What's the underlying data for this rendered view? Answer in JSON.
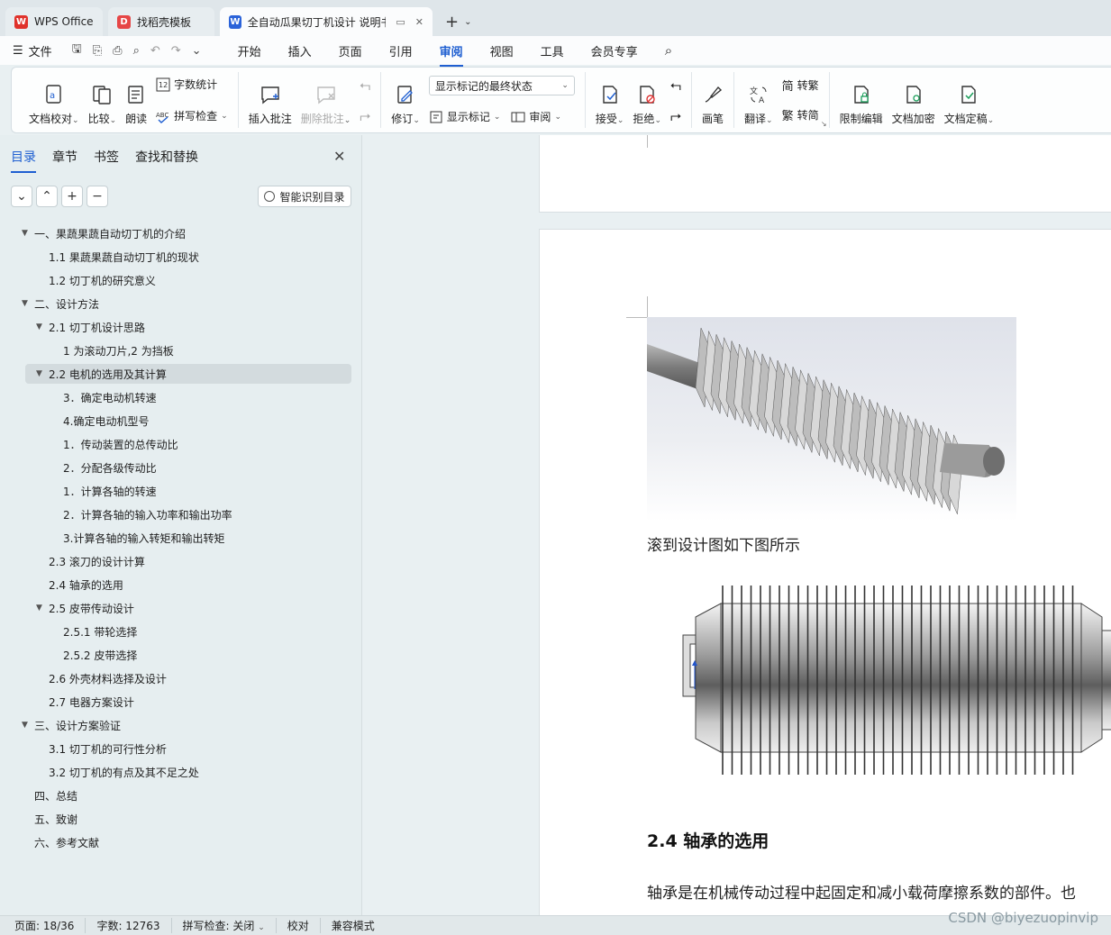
{
  "tabs": [
    {
      "label": "WPS Office",
      "logo": "W",
      "color": "#e0322b"
    },
    {
      "label": "找稻壳模板",
      "logo": "D",
      "color": "#e64646"
    },
    {
      "label": "全自动瓜果切丁机设计 说明书",
      "logo": "W",
      "color": "#2b63d9"
    }
  ],
  "menu": {
    "file_label": "文件",
    "items": [
      "开始",
      "插入",
      "页面",
      "引用",
      "审阅",
      "视图",
      "工具",
      "会员专享"
    ],
    "active_index": 4
  },
  "ribbon": {
    "proofread": "文档校对",
    "compare": "比较",
    "read_aloud": "朗读",
    "word_count": "字数统计",
    "spell_check": "拼写检查",
    "insert_comment": "插入批注",
    "delete_comment": "删除批注",
    "revise": "修订",
    "markup_state": "显示标记的最终状态",
    "show_markup": "显示标记",
    "review": "审阅",
    "accept": "接受",
    "reject": "拒绝",
    "pen": "画笔",
    "translate": "翻译",
    "to_traditional": "转繁",
    "to_simplified": "转简",
    "restrict_edit": "限制编辑",
    "encrypt": "文档加密",
    "finalize": "文档定稿"
  },
  "panel": {
    "tabs": [
      "目录",
      "章节",
      "书签",
      "查找和替换"
    ],
    "smart_button": "智能识别目录",
    "toc": [
      {
        "text": "一、果蔬果蔬自动切丁机的介绍",
        "level": 1,
        "arrow": true
      },
      {
        "text": "1.1 果蔬果蔬自动切丁机的现状",
        "level": 2,
        "arrow": false
      },
      {
        "text": "1.2 切丁机的研究意义",
        "level": 2,
        "arrow": false
      },
      {
        "text": "二、设计方法",
        "level": 1,
        "arrow": true
      },
      {
        "text": "2.1 切丁机设计思路",
        "level": 2,
        "arrow": true
      },
      {
        "text": "1 为滚动刀片,2 为挡板",
        "level": 3,
        "arrow": false
      },
      {
        "text": "2.2 电机的选用及其计算",
        "level": 2,
        "arrow": true,
        "selected": true
      },
      {
        "text": "3．确定电动机转速",
        "level": 3,
        "arrow": false
      },
      {
        "text": "4.确定电动机型号",
        "level": 3,
        "arrow": false
      },
      {
        "text": "1．传动装置的总传动比",
        "level": 3,
        "arrow": false
      },
      {
        "text": "2．分配各级传动比",
        "level": 3,
        "arrow": false
      },
      {
        "text": "1．计算各轴的转速",
        "level": 3,
        "arrow": false
      },
      {
        "text": "2．计算各轴的输入功率和输出功率",
        "level": 3,
        "arrow": false
      },
      {
        "text": "3.计算各轴的输入转矩和输出转矩",
        "level": 3,
        "arrow": false
      },
      {
        "text": "2.3 滚刀的设计计算",
        "level": 2,
        "arrow": false
      },
      {
        "text": "2.4 轴承的选用",
        "level": 2,
        "arrow": false
      },
      {
        "text": "2.5 皮带传动设计",
        "level": 2,
        "arrow": true
      },
      {
        "text": "2.5.1 带轮选择",
        "level": 3,
        "arrow": false
      },
      {
        "text": "2.5.2 皮带选择",
        "level": 3,
        "arrow": false
      },
      {
        "text": "2.6 外壳材料选择及设计",
        "level": 2,
        "arrow": false
      },
      {
        "text": "2.7 电器方案设计",
        "level": 2,
        "arrow": false
      },
      {
        "text": "三、设计方案验证",
        "level": 1,
        "arrow": true
      },
      {
        "text": "3.1 切丁机的可行性分析",
        "level": 2,
        "arrow": false
      },
      {
        "text": "3.2 切丁机的有点及其不足之处",
        "level": 2,
        "arrow": false
      },
      {
        "text": "四、总结",
        "level": 1,
        "arrow": false
      },
      {
        "text": "五、致谢",
        "level": 1,
        "arrow": false
      },
      {
        "text": "六、参考文献",
        "level": 1,
        "arrow": false
      }
    ]
  },
  "document": {
    "caption": "滚到设计图如下图所示",
    "heading": "2.4 轴承的选用",
    "body": "轴承是在机械传动过程中起固定和减小载荷摩擦系数的部件。也"
  },
  "status": {
    "page": "页面: 18/36",
    "words": "字数: 12763",
    "spell": "拼写检查: 关闭",
    "proof": "校对",
    "compat": "兼容模式"
  },
  "watermark": "CSDN @biyezuopinvip"
}
